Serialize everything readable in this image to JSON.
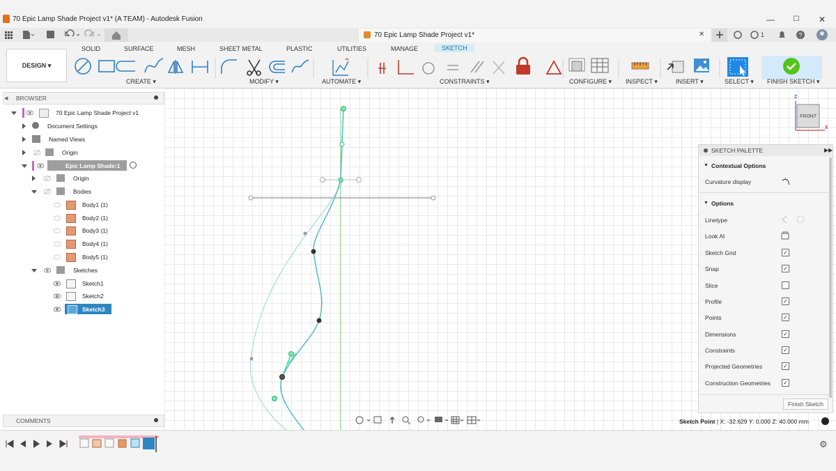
{
  "window": {
    "title": "70 Epic Lamp Shade Project v1* (A TEAM) - Autodesk Fusion",
    "controls": [
      "—",
      "☐",
      "✕"
    ]
  },
  "doc_tab": {
    "title": "70 Epic Lamp Shade Project v1*",
    "close": "✕"
  },
  "quick_access": {
    "badge_count": "1"
  },
  "ribbon": {
    "workspace": "DESIGN ▾",
    "tabs": [
      "SOLID",
      "SURFACE",
      "MESH",
      "SHEET METAL",
      "PLASTIC",
      "UTILITIES",
      "MANAGE",
      "SKETCH"
    ],
    "active_tab": "SKETCH",
    "groups": [
      "CREATE ▾",
      "MODIFY ▾",
      "AUTOMATE ▾",
      "CONSTRAINTS ▾",
      "CONFIGURE ▾",
      "INSPECT ▾",
      "INSERT ▾",
      "SELECT ▾",
      "FINISH SKETCH ▾"
    ],
    "accent": "#2e86c1",
    "finish_color": "#52c41a"
  },
  "browser": {
    "header": "BROWSER",
    "items": [
      {
        "label": "70 Epic Lamp Shade Project v1",
        "level": 0,
        "expanded": true
      },
      {
        "label": "Document Settings",
        "level": 1
      },
      {
        "label": "Named Views",
        "level": 1
      },
      {
        "label": "Origin",
        "level": 1
      },
      {
        "label": "Epic Lamp Shade:1",
        "level": 1,
        "expanded": true
      },
      {
        "label": "Origin",
        "level": 2
      },
      {
        "label": "Bodies",
        "level": 2,
        "expanded": true
      },
      {
        "label": "Body1 (1)",
        "level": 3
      },
      {
        "label": "Body2 (1)",
        "level": 3
      },
      {
        "label": "Body3 (1)",
        "level": 3
      },
      {
        "label": "Body4 (1)",
        "level": 3
      },
      {
        "label": "Body5 (1)",
        "level": 3
      },
      {
        "label": "Sketches",
        "level": 2,
        "expanded": true
      },
      {
        "label": "Sketch1",
        "level": 3
      },
      {
        "label": "Sketch2",
        "level": 3
      },
      {
        "label": "Sketch3",
        "level": 3,
        "selected": true
      }
    ]
  },
  "comments": {
    "header": "COMMENTS"
  },
  "viewcube": {
    "face": "FRONT",
    "z": "Z",
    "x": "X"
  },
  "palette": {
    "header": "SKETCH PALETTE",
    "sections": [
      "Contextual Options",
      "Options"
    ],
    "contextual": [
      {
        "label": "Curvature display",
        "type": "icon"
      }
    ],
    "options": [
      {
        "label": "Linetype",
        "type": "icon"
      },
      {
        "label": "Look At",
        "type": "icon"
      },
      {
        "label": "Sketch Grid",
        "checked": true
      },
      {
        "label": "Snap",
        "checked": true
      },
      {
        "label": "Slice",
        "checked": false
      },
      {
        "label": "Profile",
        "checked": true
      },
      {
        "label": "Points",
        "checked": true
      },
      {
        "label": "Dimensions",
        "checked": true
      },
      {
        "label": "Constraints",
        "checked": true
      },
      {
        "label": "Projected Geometries",
        "checked": true
      },
      {
        "label": "Construction Geometries",
        "checked": true
      }
    ],
    "finish_button": "Finish Sketch"
  },
  "status": {
    "label": "Sketch Point",
    "coords": " | X: -32.629  Y: 0.000  Z: 40.000 mm"
  }
}
